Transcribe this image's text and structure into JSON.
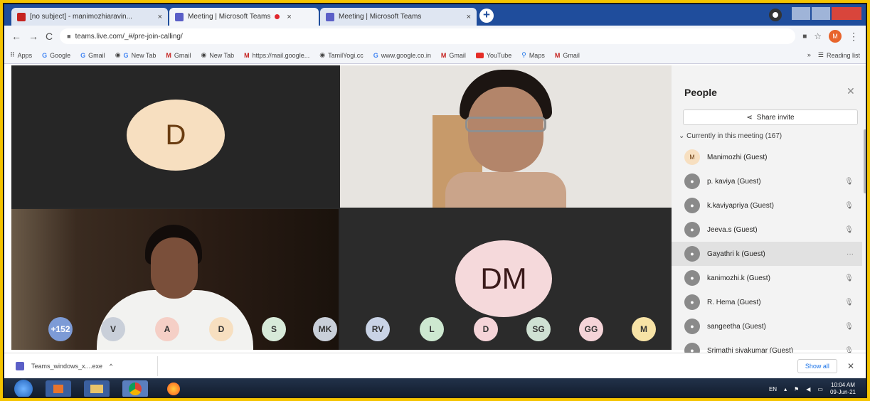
{
  "browser": {
    "tabs": [
      {
        "label": "[no subject] - manimozhiaravin...",
        "active": false
      },
      {
        "label": "Meeting | Microsoft Teams",
        "active": true
      },
      {
        "label": "Meeting | Microsoft Teams",
        "active": false
      }
    ],
    "url": "teams.live.com/_#/pre-join-calling/",
    "profile_initial": "M",
    "bookmarks": [
      "Apps",
      "Google",
      "Gmail",
      "New Tab",
      "Gmail",
      "New Tab",
      "https://mail.google...",
      "TamilYogi.cc",
      "www.google.co.in",
      "Gmail",
      "YouTube",
      "Maps",
      "Gmail"
    ],
    "reading_list": "Reading list"
  },
  "meeting": {
    "tile1_initial": "D",
    "tile4_initials": "DM",
    "participant_strip": [
      "+152",
      "V",
      "A",
      "D",
      "S",
      "MK",
      "RV",
      "L",
      "D",
      "SG",
      "GG",
      "M"
    ],
    "strip_colors": [
      "#7d9bd6",
      "#c9cfd9",
      "#f5cfc6",
      "#f7dfc0",
      "#d7ead9",
      "#c9cfd9",
      "#c9d3e6",
      "#cde8d0",
      "#f5d4d8",
      "#cfe1d3",
      "#f5d4d8",
      "#f7e3a6"
    ]
  },
  "people": {
    "title": "People",
    "share_label": "Share invite",
    "section": "Currently in this meeting (167)",
    "participants": [
      {
        "name": "Manimozhi (Guest)",
        "initial": "M",
        "highlight": false
      },
      {
        "name": "p. kaviya (Guest)",
        "initial": "",
        "highlight": false
      },
      {
        "name": "k.kaviyapriya (Guest)",
        "initial": "",
        "highlight": false
      },
      {
        "name": "Jeeva.s (Guest)",
        "initial": "",
        "highlight": false
      },
      {
        "name": "Gayathri k (Guest)",
        "initial": "",
        "highlight": true
      },
      {
        "name": "kanimozhi.k (Guest)",
        "initial": "",
        "highlight": false
      },
      {
        "name": "R. Hema (Guest)",
        "initial": "",
        "highlight": false
      },
      {
        "name": "sangeetha (Guest)",
        "initial": "",
        "highlight": false
      },
      {
        "name": "Srimathi sivakumar (Guest)",
        "initial": "",
        "highlight": false
      }
    ]
  },
  "downloads": {
    "file": "Teams_windows_x....exe",
    "show_all": "Show all"
  },
  "taskbar": {
    "lang": "EN",
    "time": "10:04 AM",
    "date": "09-Jun-21"
  }
}
